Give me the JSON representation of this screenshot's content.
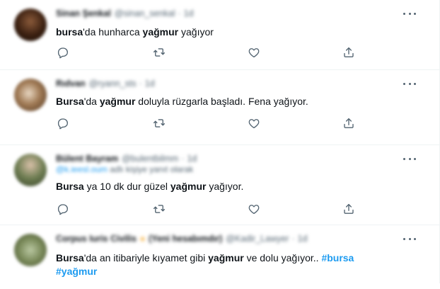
{
  "colors": {
    "text": "#0f1419",
    "muted": "#536471",
    "link": "#1d9bf0",
    "divider": "#eff3f4"
  },
  "tweets": [
    {
      "name": "Sinan Şenkal",
      "handle": "@sinan_senkal",
      "time": "1d",
      "text_parts": [
        {
          "t": "bursa",
          "b": true
        },
        {
          "t": "'da hunharca "
        },
        {
          "t": "yağmur",
          "b": true
        },
        {
          "t": " yağıyor"
        }
      ]
    },
    {
      "name": "Rıdvan",
      "handle": "@ryann_sts",
      "time": "1d",
      "text_parts": [
        {
          "t": "Bursa",
          "b": true
        },
        {
          "t": "'da "
        },
        {
          "t": "yağmur",
          "b": true
        },
        {
          "t": " doluyla rüzgarla başladı. Fena yağıyor."
        }
      ]
    },
    {
      "name": "Bülent Bayram",
      "handle": "@bulentbilmm",
      "time": "1d",
      "replying_handle": "@k.ieesl.oum",
      "replying_text": "adlı kişiye yanıt olarak",
      "text_parts": [
        {
          "t": "Bursa",
          "b": true
        },
        {
          "t": " ya 10 dk dur güzel "
        },
        {
          "t": "yağmur",
          "b": true
        },
        {
          "t": " yağıyor."
        }
      ]
    },
    {
      "name": "Corpus Iuris Civilis",
      "badge_text": "(Yeni hesabımdır)",
      "handle": "@Kadir_Lawyer",
      "time": "1d",
      "text_parts": [
        {
          "t": "Bursa",
          "b": true
        },
        {
          "t": "'da an itibariyle kıyamet gibi "
        },
        {
          "t": "yağmur",
          "b": true
        },
        {
          "t": " ve dolu yağıyor.. "
        },
        {
          "t": "#bursa",
          "tag": true
        },
        {
          "t": " "
        },
        {
          "t": "#yağmur",
          "tag": true
        }
      ]
    }
  ],
  "icons": {
    "more": "more-icon",
    "reply": "reply-icon",
    "retweet": "retweet-icon",
    "like": "like-icon",
    "share": "share-icon"
  }
}
